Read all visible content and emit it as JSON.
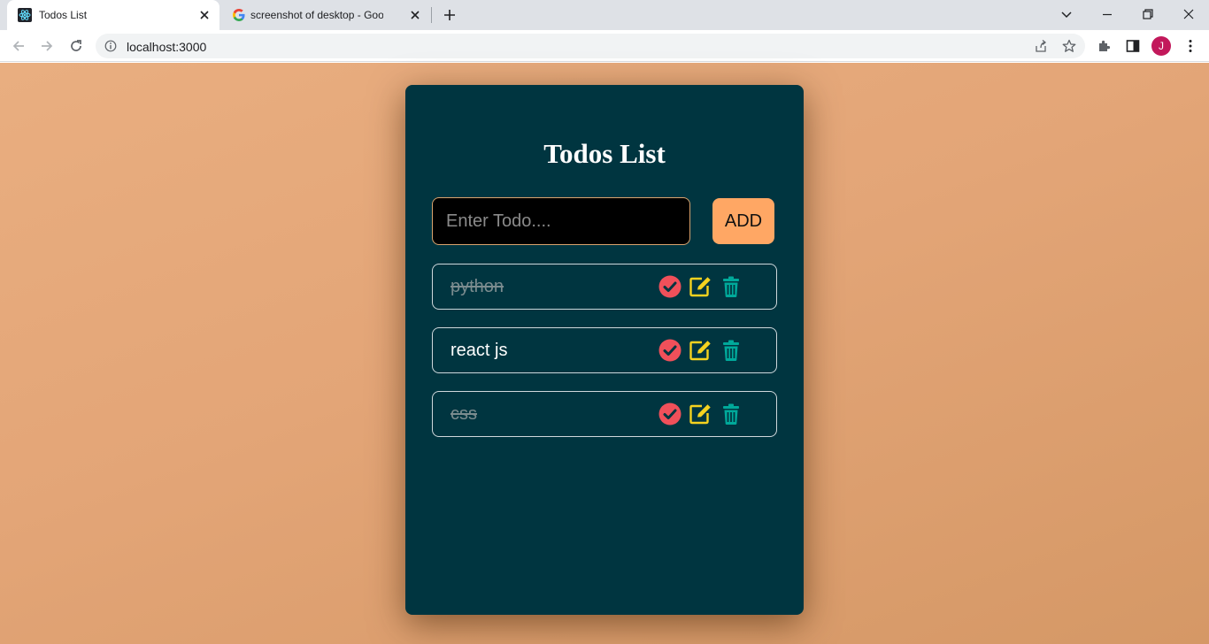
{
  "browser": {
    "tabs": [
      {
        "title": "Todos List"
      },
      {
        "title": "screenshot of desktop - Google S"
      }
    ],
    "url": "localhost:3000",
    "profile_initial": "J"
  },
  "app": {
    "title": "Todos List",
    "input_placeholder": "Enter Todo....",
    "input_value": "",
    "add_label": "ADD",
    "colors": {
      "background": "#e3a577",
      "card": "#003540",
      "add_button": "#ffa764",
      "check_icon": "#f0505a",
      "edit_icon": "#f5d21f",
      "delete_icon": "#00a99a"
    },
    "todos": [
      {
        "text": "python",
        "completed": true
      },
      {
        "text": "react js",
        "completed": false
      },
      {
        "text": "css",
        "completed": true
      }
    ]
  }
}
